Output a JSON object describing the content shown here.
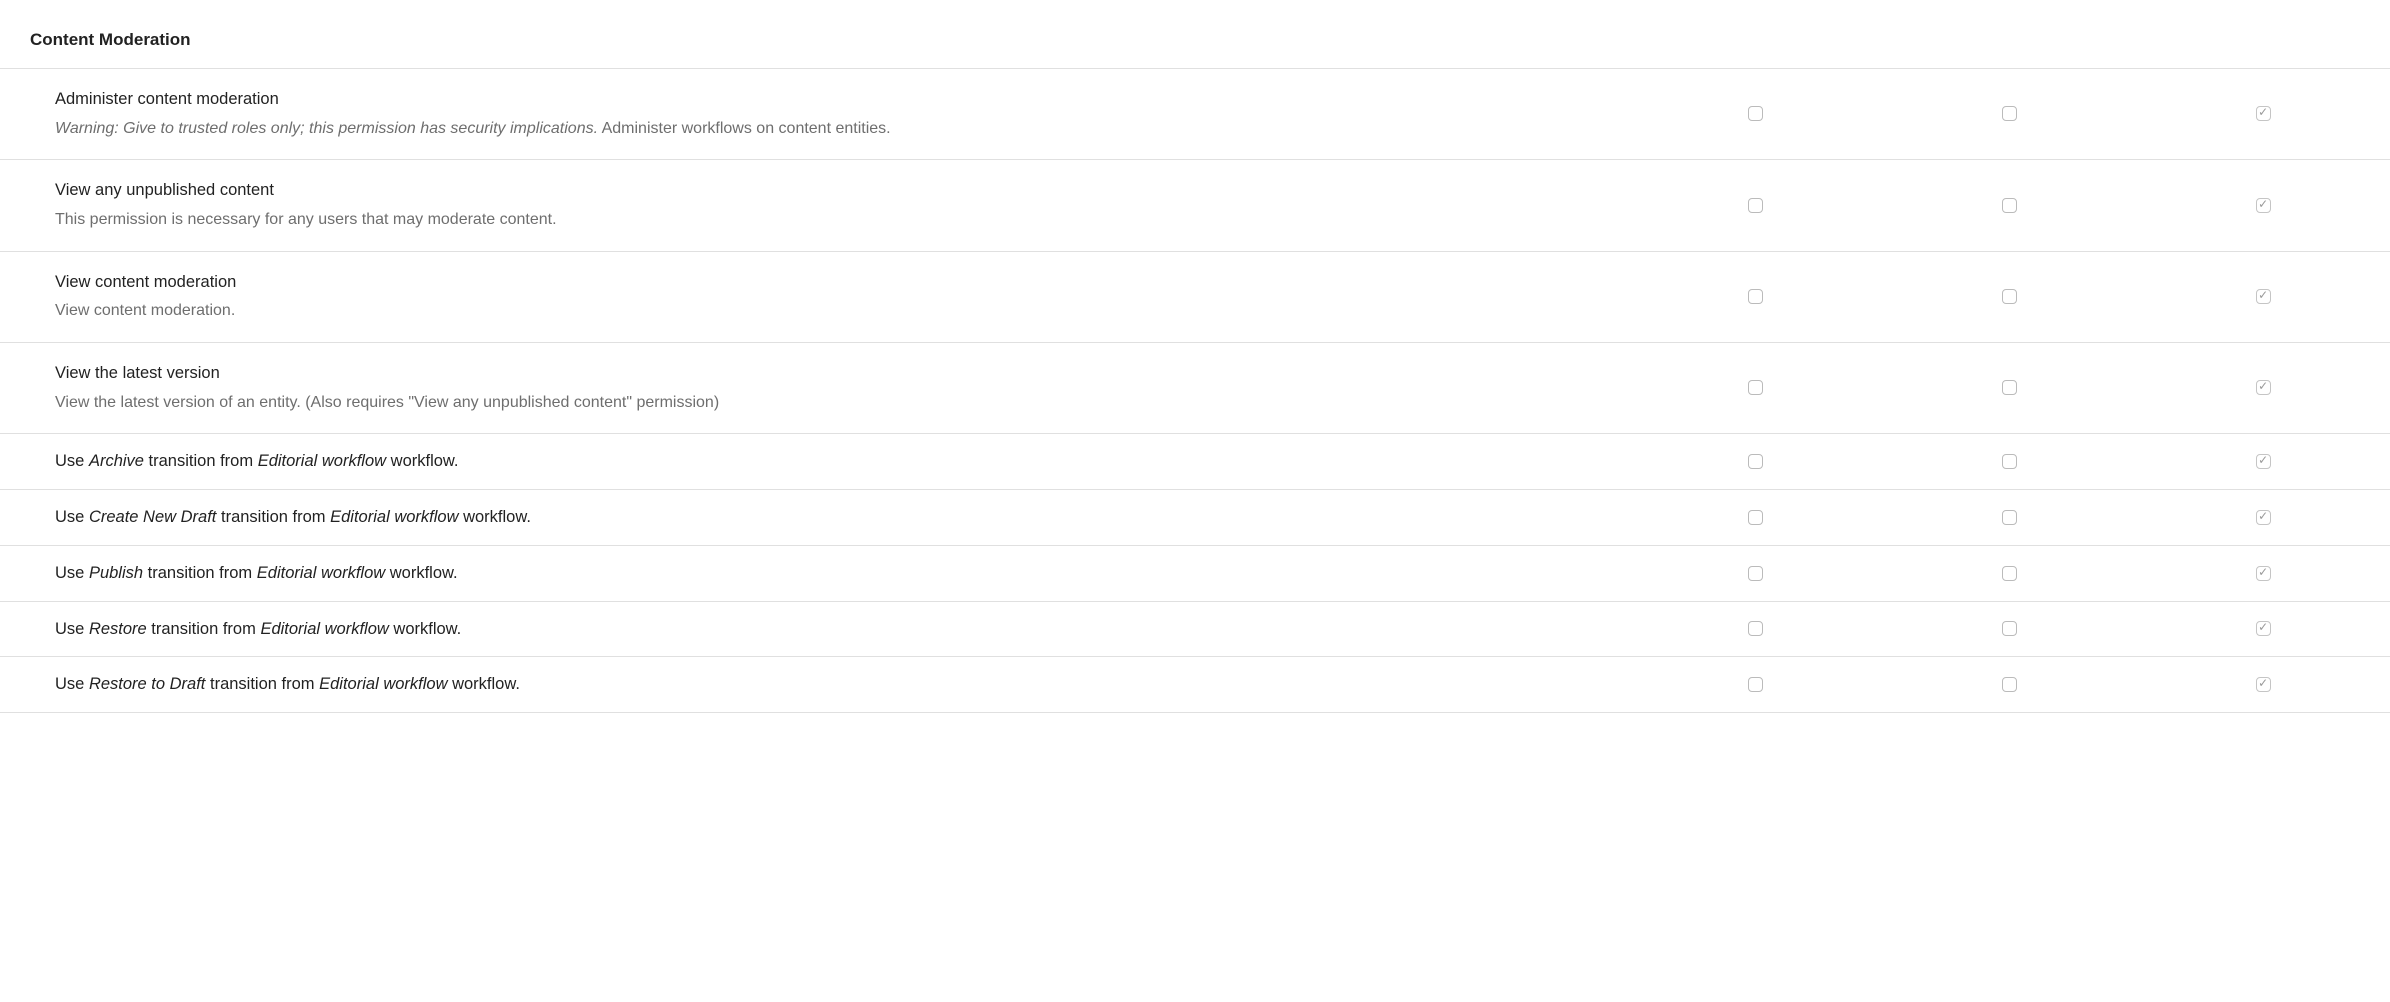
{
  "section_title": "Content Moderation",
  "permissions": [
    {
      "title_html": "Administer content moderation",
      "desc_html": "<span class='warn'>Warning: Give to trusted roles only; this permission has security implications.</span> Administer workflows on content entities.",
      "checks": [
        false,
        false,
        true
      ],
      "disabled": [
        false,
        false,
        true
      ],
      "compact": false
    },
    {
      "title_html": "View any unpublished content",
      "desc_html": "This permission is necessary for any users that may moderate content.",
      "checks": [
        false,
        false,
        true
      ],
      "disabled": [
        false,
        false,
        true
      ],
      "compact": false
    },
    {
      "title_html": "View content moderation",
      "desc_html": "View content moderation.",
      "checks": [
        false,
        false,
        true
      ],
      "disabled": [
        false,
        false,
        true
      ],
      "compact": false
    },
    {
      "title_html": "View the latest version",
      "desc_html": "View the latest version of an entity. (Also requires \"View any unpublished content\" permission)",
      "checks": [
        false,
        false,
        true
      ],
      "disabled": [
        false,
        false,
        true
      ],
      "compact": false
    },
    {
      "title_html": "Use <em>Archive</em> transition from <em>Editorial workflow</em> workflow.",
      "desc_html": "",
      "checks": [
        false,
        false,
        true
      ],
      "disabled": [
        false,
        false,
        true
      ],
      "compact": true
    },
    {
      "title_html": "Use <em>Create New Draft</em> transition from <em>Editorial workflow</em> workflow.",
      "desc_html": "",
      "checks": [
        false,
        false,
        true
      ],
      "disabled": [
        false,
        false,
        true
      ],
      "compact": true
    },
    {
      "title_html": "Use <em>Publish</em> transition from <em>Editorial workflow</em> workflow.",
      "desc_html": "",
      "checks": [
        false,
        false,
        true
      ],
      "disabled": [
        false,
        false,
        true
      ],
      "compact": true
    },
    {
      "title_html": "Use <em>Restore</em> transition from <em>Editorial workflow</em> workflow.",
      "desc_html": "",
      "checks": [
        false,
        false,
        true
      ],
      "disabled": [
        false,
        false,
        true
      ],
      "compact": true
    },
    {
      "title_html": "Use <em>Restore to Draft</em> transition from <em>Editorial workflow</em> workflow.",
      "desc_html": "",
      "checks": [
        false,
        false,
        true
      ],
      "disabled": [
        false,
        false,
        true
      ],
      "compact": true
    }
  ]
}
